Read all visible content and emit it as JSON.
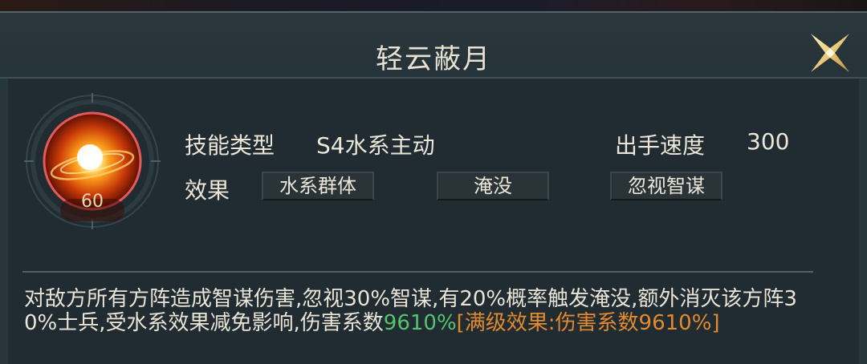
{
  "title": "轻云蔽月",
  "skill": {
    "level": "60",
    "type_label": "技能类型",
    "type_value": "S4水系主动",
    "speed_label": "出手速度",
    "speed_value": "300",
    "effect_label": "效果",
    "effect_tags": [
      "水系群体",
      "淹没",
      "忽视智谋"
    ]
  },
  "description": {
    "main": "对敌方所有方阵造成智谋伤害,忽视30%智谋,有20%概率触发淹没,额外消灭该方阵30%士兵,受水系效果减免影响,伤害系数",
    "coefficient": "9610%",
    "max_level": "[满级效果:伤害系数9610%]"
  },
  "colors": {
    "text": "#ece6d8",
    "highlight_green": "#57c36c",
    "highlight_orange": "#e48a2e",
    "gold": "#e8c97a"
  },
  "icons": {
    "close": "close-x-icon",
    "skill": "fire-orb-icon"
  }
}
